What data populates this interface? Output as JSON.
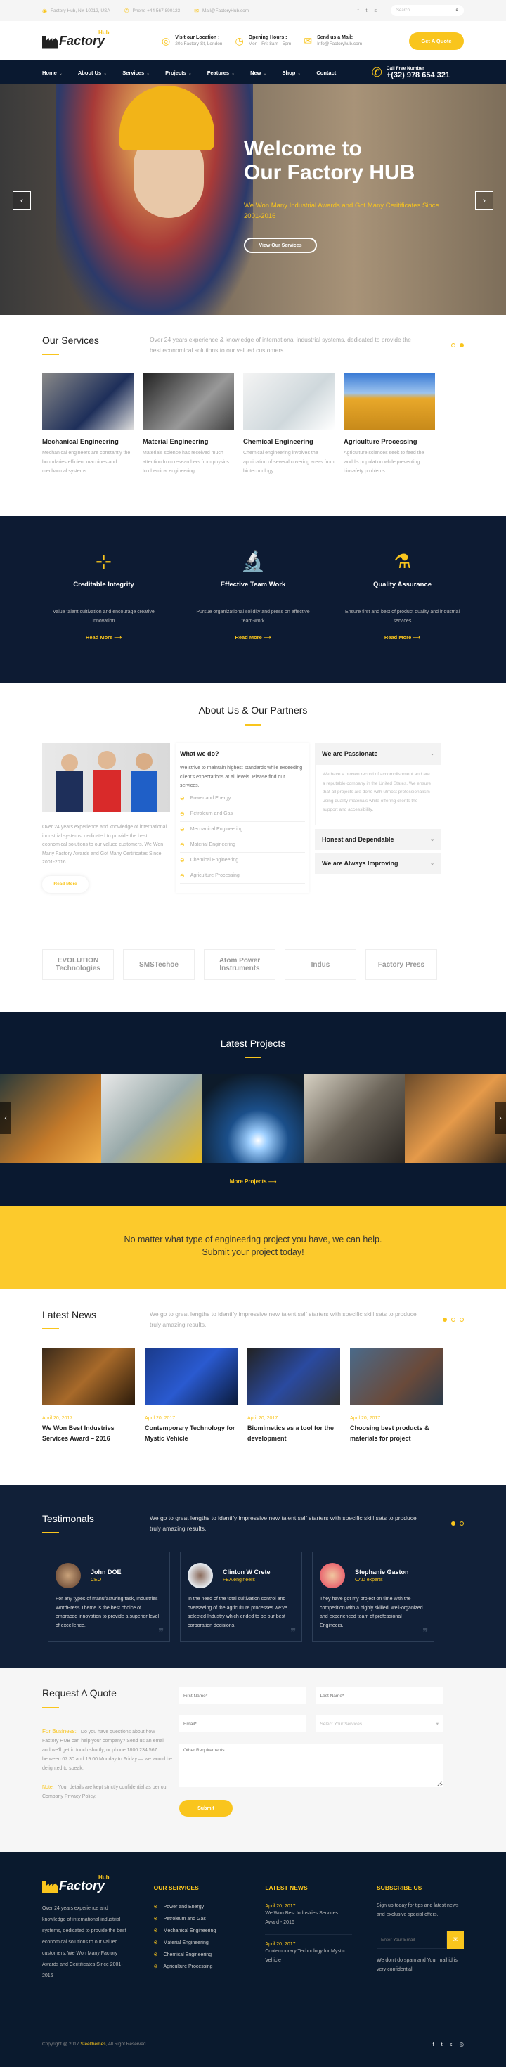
{
  "topbar": {
    "address": "Factory Hub, NY 10012, USA",
    "phone": "Phone +44 567 890123",
    "email": "Mail@FactoryHub.com",
    "social": [
      "f",
      "t",
      "s"
    ],
    "search_placeholder": "Search ..."
  },
  "header": {
    "logo_text": "Factory",
    "logo_sup": "Hub",
    "location_label": "Visit our Location :",
    "location_value": "20c Factory St, London",
    "hours_label": "Opening Hours :",
    "hours_value": "Mon - Fri: 8am - 5pm",
    "mail_label": "Send us a Mail:",
    "mail_value": "Info@Factoryhub.com",
    "quote_button": "Get A Quote"
  },
  "nav": {
    "items": [
      {
        "label": "Home",
        "has_sub": true
      },
      {
        "label": "About Us",
        "has_sub": true
      },
      {
        "label": "Services",
        "has_sub": true
      },
      {
        "label": "Projects",
        "has_sub": true
      },
      {
        "label": "Features",
        "has_sub": true
      },
      {
        "label": "New",
        "has_sub": true
      },
      {
        "label": "Shop",
        "has_sub": true
      },
      {
        "label": "Contact",
        "has_sub": false
      }
    ],
    "call_label": "Call Free Number",
    "call_number": "+(32) 978 654 321"
  },
  "hero": {
    "title_line1": "Welcome to",
    "title_line2": "Our Factory HUB",
    "subtitle": "We Won Many Industrial Awards and Got Many Ceritificates Since 2001-2016",
    "button": "View Our Services",
    "prev": "‹",
    "next": "›"
  },
  "services": {
    "title": "Our Services",
    "description": "Over 24 years experience & knowledge of international industrial systems, dedicated to provide the best economical solutions to our valued customers.",
    "active_dot": 2,
    "items": [
      {
        "title": "Mechanical Engineering",
        "desc": "Mechanical engineers are constantly the boundaries efficient machines and mechanical systems."
      },
      {
        "title": "Material Engineering",
        "desc": "Materials science has received much attention from researchers from physics to chemical engineering"
      },
      {
        "title": "Chemical Engineering",
        "desc": "Chemical engineering involves the application of several covering areas from biotechnology."
      },
      {
        "title": "Agriculture Processing",
        "desc": "Agriculture sciences seek to feed the world's population while preventing biosafety problems ."
      }
    ]
  },
  "features": {
    "items": [
      {
        "icon": "graph-icon",
        "title": "Creditable Integrity",
        "desc": "Value talent cultivation and encourage creative innovation",
        "link": "Read More"
      },
      {
        "icon": "microscope-icon",
        "title": "Effective Team Work",
        "desc": "Pursue organizational solidity and press on effective team-work",
        "link": "Read More"
      },
      {
        "icon": "flask-icon",
        "title": "Quality Assurance",
        "desc": "Ensure first and best of product quality and industrial services",
        "link": "Read More"
      }
    ]
  },
  "about": {
    "title": "About Us & Our Partners",
    "text": "Over 24 years experience and knowledge of international industrial systems, dedicated to provide the best economical solutions to our valued customers. We Won Many Factory Awards and Got Many Certificates Since 2001-2016",
    "read_more": "Read More",
    "what_we_do_title": "What we do?",
    "what_we_do_text": "We strive to maintain highest standards while exceeding client's expectations at all levels. Please find our services.",
    "what_we_do_list": [
      "Power and Energy",
      "Petroleum and Gas",
      "Mechanical Engineering",
      "Material Engineering",
      "Chemical Engineering",
      "Agriculture Processing"
    ],
    "accordion": [
      {
        "title": "We are Passionate",
        "open": true,
        "body": "We have a proven record of accomplishment and are a reputable company in the United States. We ensure that all projects are done with utmost professionalism using quality materials while offering clients the support and accessibility."
      },
      {
        "title": "Honest and Dependable",
        "open": false
      },
      {
        "title": "We are Always Improving",
        "open": false
      }
    ],
    "partners": [
      "EVOLUTION Technologies",
      "SMSTechoe",
      "Atom Power Instruments",
      "Indus",
      "Factory Press"
    ]
  },
  "projects": {
    "title": "Latest Projects",
    "more": "More Projects ⟶",
    "prev": "‹",
    "next": "›"
  },
  "cta": {
    "line1": "No matter what type of engineering project you have, we can help.",
    "line2": "Submit your project today!"
  },
  "news": {
    "title": "Latest News",
    "description": "We go to great lengths to identify impressive new talent self starters with specific skill sets to produce truly amazing results.",
    "active_dot": 1,
    "items": [
      {
        "date": "April 20, 2017",
        "title": "We Won Best Industries Services Award – 2016"
      },
      {
        "date": "April 20, 2017",
        "title": "Contemporary Technology for Mystic Vehicle"
      },
      {
        "date": "April 20, 2017",
        "title": "Biomimetics as a tool for the development"
      },
      {
        "date": "April 20, 2017",
        "title": "Choosing best products & materials for project"
      }
    ]
  },
  "testimonials": {
    "title": "Testimonals",
    "description": "We go to great lengths to identify impressive new talent self starters with specific skill sets to produce truly amazing results.",
    "active_dot": 1,
    "items": [
      {
        "name": "John DOE",
        "role": "CEO",
        "text": "For any types of manufacturing task, Industries WordPress Theme is the best choice of embraced innovation to provide a superior level of excellence."
      },
      {
        "name": "Clinton W Crete",
        "role": "FEA engineers",
        "text": "In the need of the total cultivation control and overseeing of the agriculture processes we've selected Industry which ended to be our best corporation decisions."
      },
      {
        "name": "Stephanie Gaston",
        "role": "CAD experts",
        "text": "They have got my project on time with the competition with a highly skilled, well-organized and experienced team of professional Engineers."
      }
    ]
  },
  "quote": {
    "title": "Request A Quote",
    "business_label": "For Business:",
    "business_text": "Do you have questions about how Factory HUB can help your company? Send us an email and we'll get in touch shortly, or phone 1800 234 567 between 07:30 and 19:00 Monday to Friday — we would be delighted to speak.",
    "note_label": "Note:",
    "note_text": "Your details are kept strictly confidential as per our Company Privacy Policy.",
    "first_name_placeholder": "First Name*",
    "last_name_placeholder": "Last Name*",
    "email_placeholder": "Email*",
    "services_select": "Select Your Services",
    "requirements_placeholder": "Other Requirements...",
    "submit": "Submit"
  },
  "footer": {
    "about_text": "Over 24 years experience and knowledge of international industrial systems, dedicated to provide the best economical solutions to our valued customers. We Won Many Factory Awards and Ceritificates Since 2001-2016",
    "services_title": "OUR SERVICES",
    "services": [
      "Power and Energy",
      "Petroleum and Gas",
      "Mechanical Engineering",
      "Material Engineering",
      "Chemical Engineering",
      "Agriculture Processing"
    ],
    "news_title": "LATEST NEWS",
    "news": [
      {
        "date": "April 20, 2017",
        "title": "We Won Best Industries Services Award - 2016"
      },
      {
        "date": "April 20, 2017",
        "title": "Contemporary Technology for Mystic Vehicle"
      }
    ],
    "subscribe_title": "SUBSCRIBE US",
    "subscribe_text": "Sign up today for tips and latest news and exclusive special offers.",
    "email_placeholder": "Enter Your Email",
    "subscribe_note": "We don't do spam and Your mail id is very confidential.",
    "copyright_prefix": "Copyright @ 2017",
    "copyright_brand": "Steelthemes",
    "copyright_suffix": ", All Right Reserved"
  },
  "colors": {
    "accent": "#f9c51d",
    "dark": "#0a1930"
  }
}
